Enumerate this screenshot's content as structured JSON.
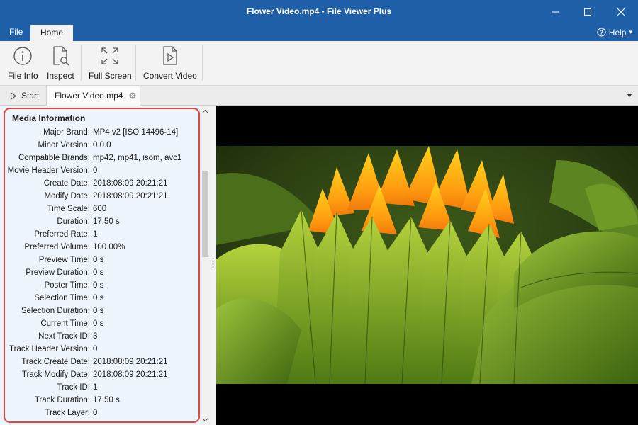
{
  "window": {
    "title": "Flower Video.mp4 - File Viewer Plus"
  },
  "menu": {
    "file": "File",
    "home": "Home",
    "help": "Help",
    "help_caret": "▾"
  },
  "ribbon": {
    "buttons": [
      {
        "label": "File Info",
        "icon": "info-icon"
      },
      {
        "label": "Inspect",
        "icon": "inspect-icon"
      },
      {
        "label": "Full Screen",
        "icon": "fullscreen-icon"
      },
      {
        "label": "Convert Video",
        "icon": "convert-video-icon"
      }
    ]
  },
  "tabs": {
    "start": "Start",
    "document": "Flower Video.mp4"
  },
  "media_info": {
    "title": "Media Information",
    "rows": [
      {
        "key": "Major Brand:",
        "value": "MP4 v2 [ISO 14496-14]"
      },
      {
        "key": "Minor Version:",
        "value": "0.0.0"
      },
      {
        "key": "Compatible Brands:",
        "value": "mp42, mp41, isom, avc1"
      },
      {
        "key": "Movie Header Version:",
        "value": "0"
      },
      {
        "key": "Create Date:",
        "value": "2018:08:09 20:21:21"
      },
      {
        "key": "Modify Date:",
        "value": "2018:08:09 20:21:21"
      },
      {
        "key": "Time Scale:",
        "value": "600"
      },
      {
        "key": "Duration:",
        "value": "17.50 s"
      },
      {
        "key": "Preferred Rate:",
        "value": "1"
      },
      {
        "key": "Preferred Volume:",
        "value": "100.00%"
      },
      {
        "key": "Preview Time:",
        "value": "0 s"
      },
      {
        "key": "Preview Duration:",
        "value": "0 s"
      },
      {
        "key": "Poster Time:",
        "value": "0 s"
      },
      {
        "key": "Selection Time:",
        "value": "0 s"
      },
      {
        "key": "Selection Duration:",
        "value": "0 s"
      },
      {
        "key": "Current Time:",
        "value": "0 s"
      },
      {
        "key": "Next Track ID:",
        "value": "3"
      },
      {
        "key": "Track Header Version:",
        "value": "0"
      },
      {
        "key": "Track Create Date:",
        "value": "2018:08:09 20:21:21"
      },
      {
        "key": "Track Modify Date:",
        "value": "2018:08:09 20:21:21"
      },
      {
        "key": "Track ID:",
        "value": "1"
      },
      {
        "key": "Track Duration:",
        "value": "17.50 s"
      },
      {
        "key": "Track Layer:",
        "value": "0"
      }
    ]
  },
  "colors": {
    "titlebar": "#1e5fa8",
    "panel_bg": "#eef4fb",
    "highlight": "#e0463f"
  }
}
